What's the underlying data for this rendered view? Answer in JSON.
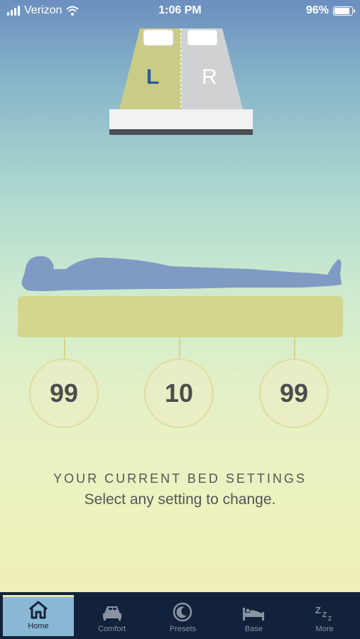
{
  "status_bar": {
    "carrier": "Verizon",
    "time": "1:06 PM",
    "battery": "96%",
    "battery_level": 0.96
  },
  "bed": {
    "left_label": "L",
    "right_label": "R",
    "selected_side": "L"
  },
  "settings": [
    {
      "value": "99"
    },
    {
      "value": "10"
    },
    {
      "value": "99"
    }
  ],
  "info": {
    "title": "YOUR CURRENT BED SETTINGS",
    "subtitle": "Select any setting to change."
  },
  "tabs": [
    {
      "label": "Home",
      "icon": "home-icon",
      "active": true
    },
    {
      "label": "Comfort",
      "icon": "bed-comfort-icon"
    },
    {
      "label": "Presets",
      "icon": "moon-icon"
    },
    {
      "label": "Base",
      "icon": "bed-base-icon"
    },
    {
      "label": "More",
      "icon": "zzz-icon"
    }
  ],
  "colors": {
    "mattress": "#d3d68c",
    "sleeper": "#7f9ac3",
    "tab_bar": "#11223a",
    "tab_active": "#8ab8d4",
    "side_left": "#c9cc86",
    "side_right": "#cfd1d3"
  }
}
